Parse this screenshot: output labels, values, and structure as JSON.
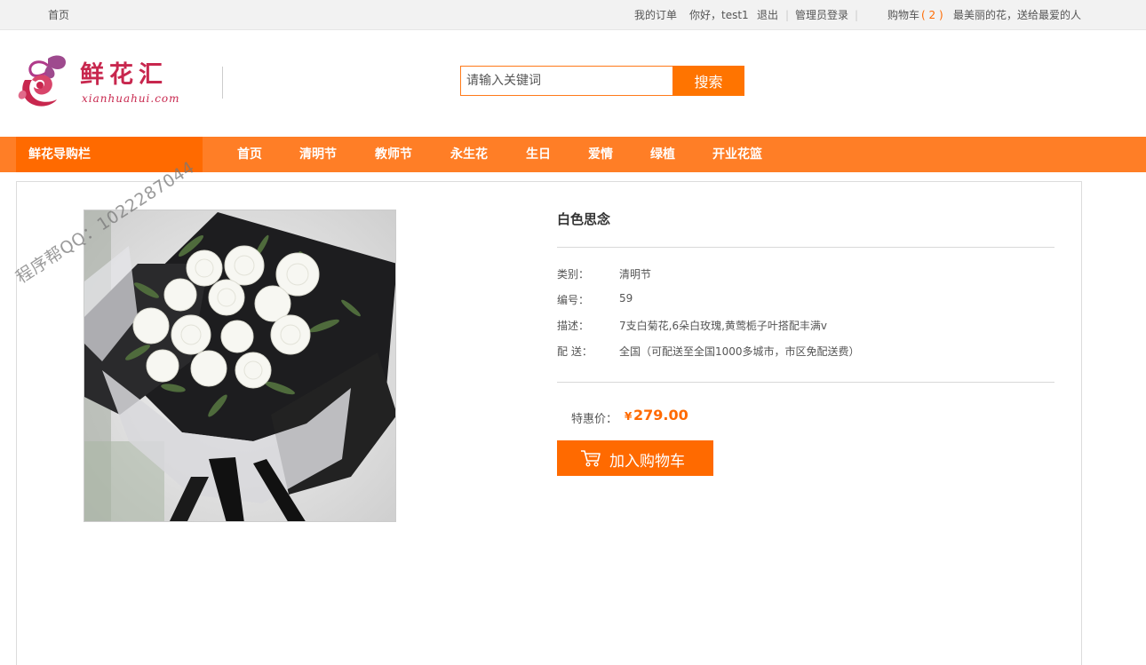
{
  "topbar": {
    "home": "首页",
    "my_orders": "我的订单",
    "greeting": "你好，test1",
    "logout": "退出",
    "admin_login": "管理员登录",
    "separator": "|",
    "cart_label": "购物车",
    "cart_count": "( 2 )",
    "slogan": "最美丽的花，送给最爱的人"
  },
  "logo": {
    "cn": "鲜花汇",
    "en": "xianhuahui.com"
  },
  "search": {
    "placeholder": "请输入关键词",
    "button": "搜索"
  },
  "nav": {
    "guide": "鲜花导购栏",
    "items": [
      "首页",
      "清明节",
      "教师节",
      "永生花",
      "生日",
      "爱情",
      "绿植",
      "开业花篮"
    ]
  },
  "watermark": "程序帮QQ：1022287044",
  "product": {
    "title": "白色思念",
    "category_label": "类别：",
    "category": "清明节",
    "id_label": "编号：",
    "id": "59",
    "desc_label": "描述：",
    "desc": "7支白菊花,6朵白玫瑰,黄莺栀子叶搭配丰满v",
    "delivery_label": "配 送：",
    "delivery": "全国（可配送至全国1000多城市，市区免配送费）",
    "price_label": "特惠价：",
    "currency": "¥",
    "price": "279.00",
    "add_to_cart": "加入购物车"
  },
  "colors": {
    "accent": "#ff6a00",
    "nav_bg": "#ff7e26",
    "brand": "#c8274e"
  }
}
